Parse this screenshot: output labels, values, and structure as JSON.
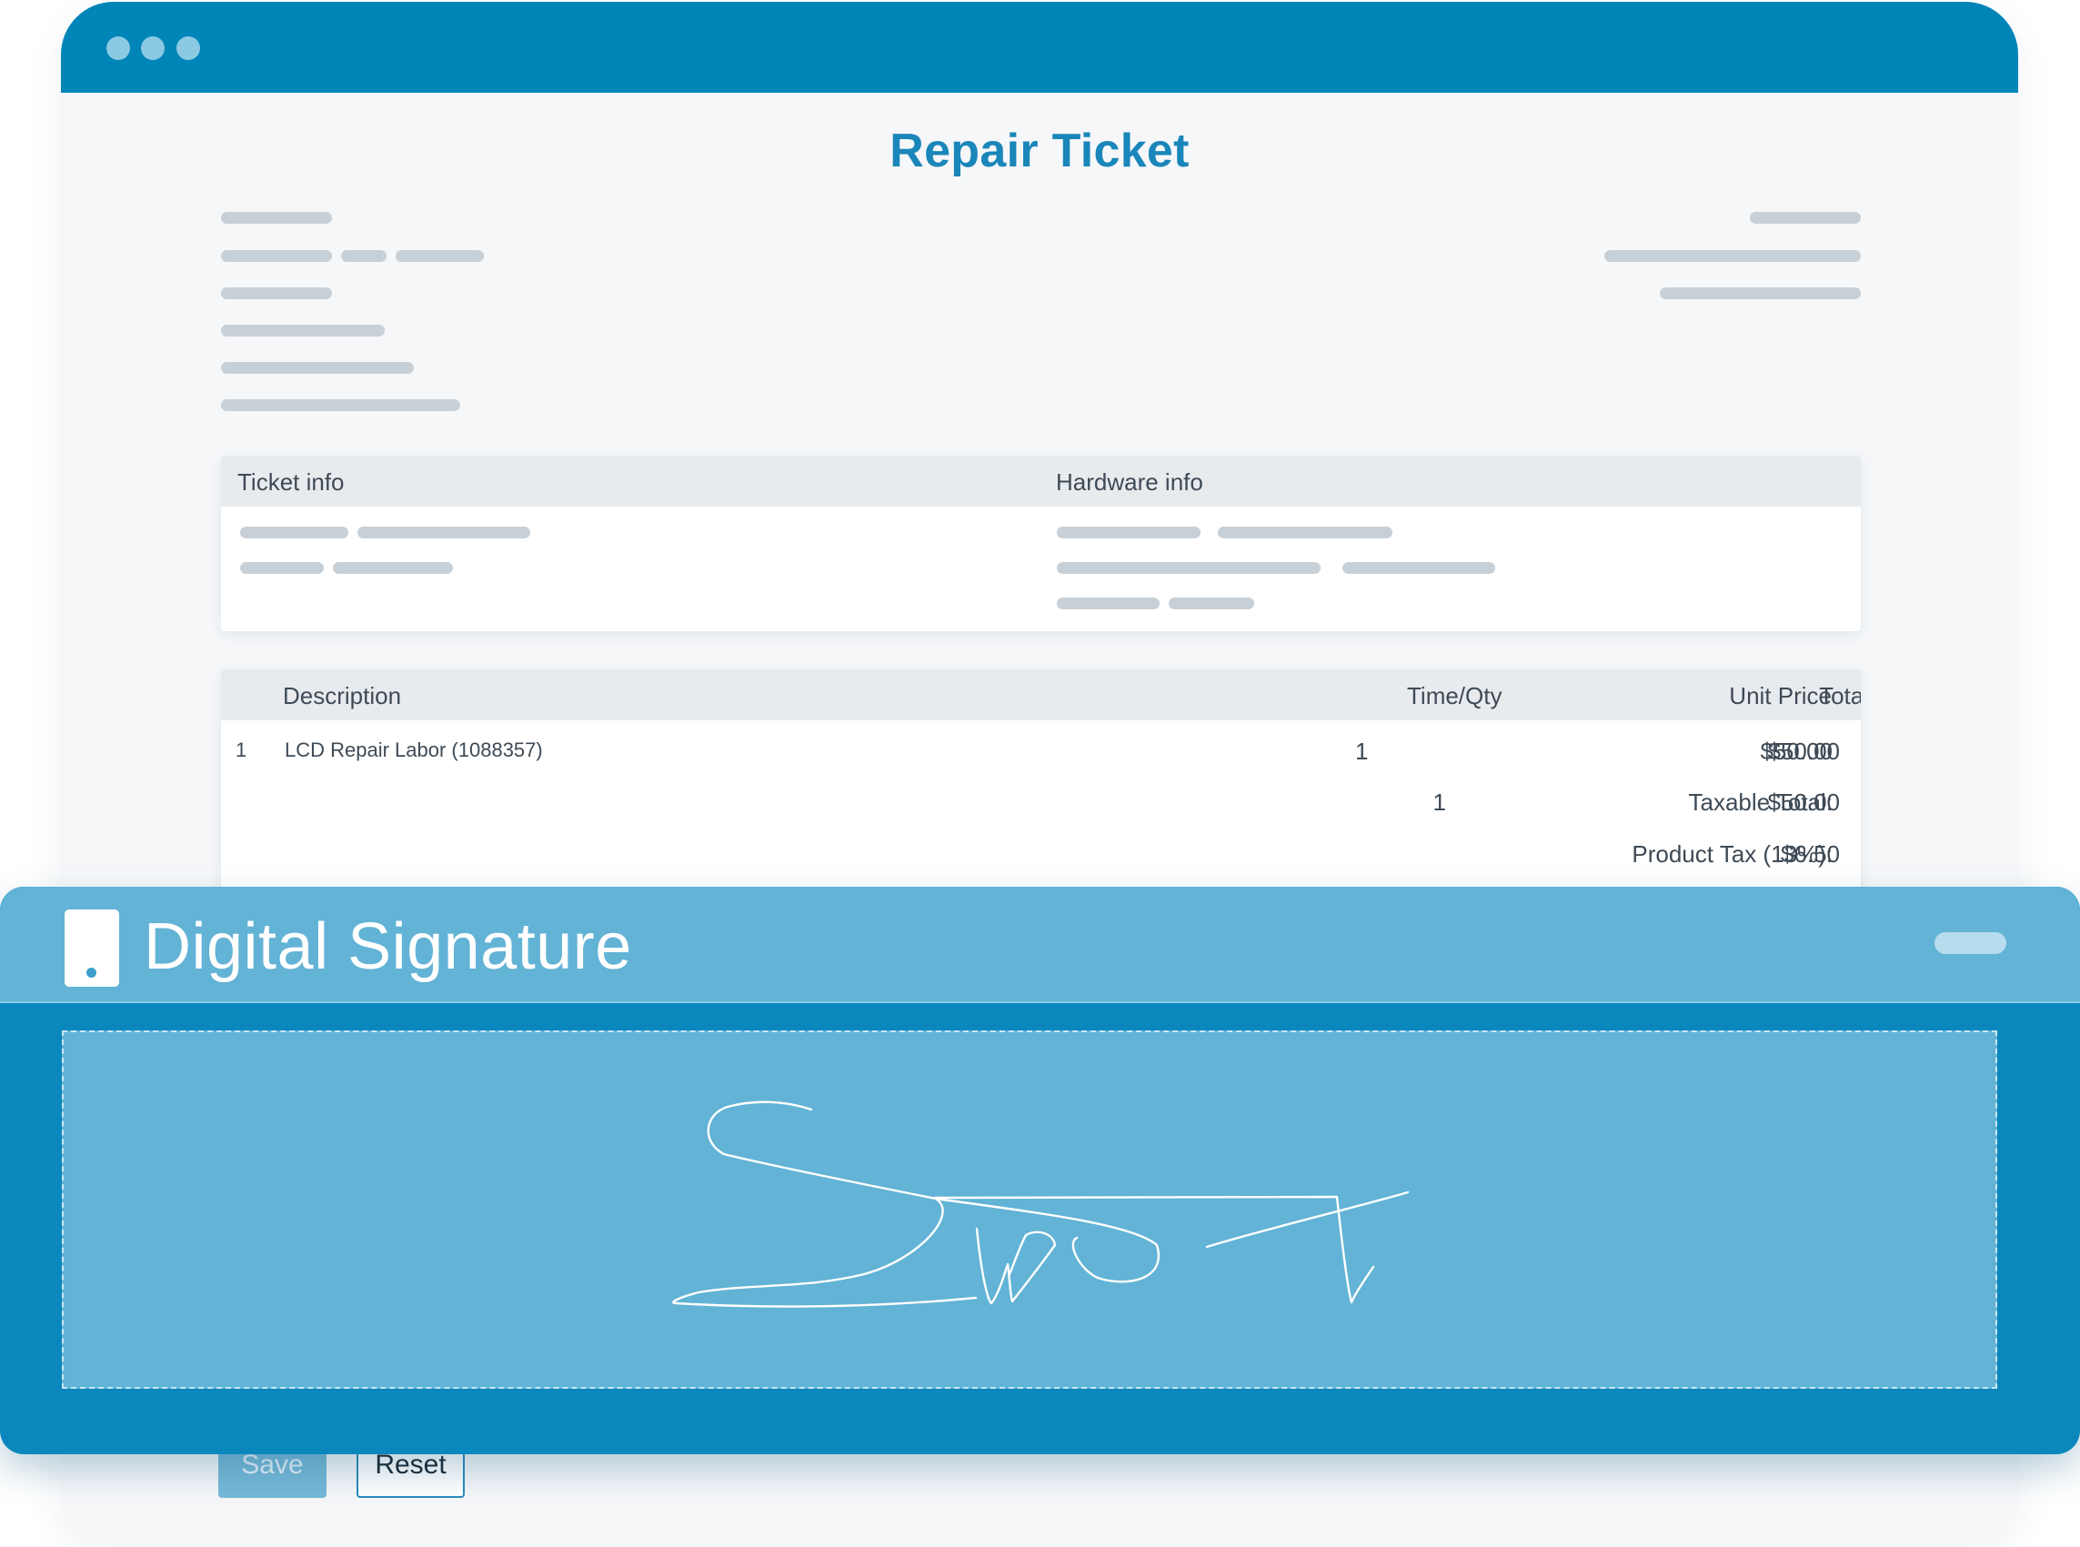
{
  "document": {
    "title": "Repair Ticket"
  },
  "info_panel": {
    "ticket_header": "Ticket info",
    "hardware_header": "Hardware info"
  },
  "items_table": {
    "columns": {
      "description": "Description",
      "qty": "Time/Qty",
      "unit_price": "Unit Price",
      "total": "Total"
    },
    "rows": [
      {
        "index": "1",
        "description": "LCD Repair Labor (1088357)",
        "qty": "1",
        "unit_price": "$50.00",
        "total": "$50.00"
      }
    ],
    "summary": [
      {
        "qty": "1",
        "label": "Taxable Total:",
        "value": "$50.00"
      },
      {
        "qty": "",
        "label": "Product Tax (13%):",
        "value": "$6.50"
      }
    ]
  },
  "actions": {
    "save_label": "Save",
    "reset_label": "Reset"
  },
  "signature": {
    "title": "Digital Signature",
    "icon": "tablet-icon"
  },
  "colors": {
    "titlebar": "#0085b8",
    "accent": "#1a86b9",
    "modal": "#0a88bd",
    "modal_header": "#62b3d5"
  }
}
